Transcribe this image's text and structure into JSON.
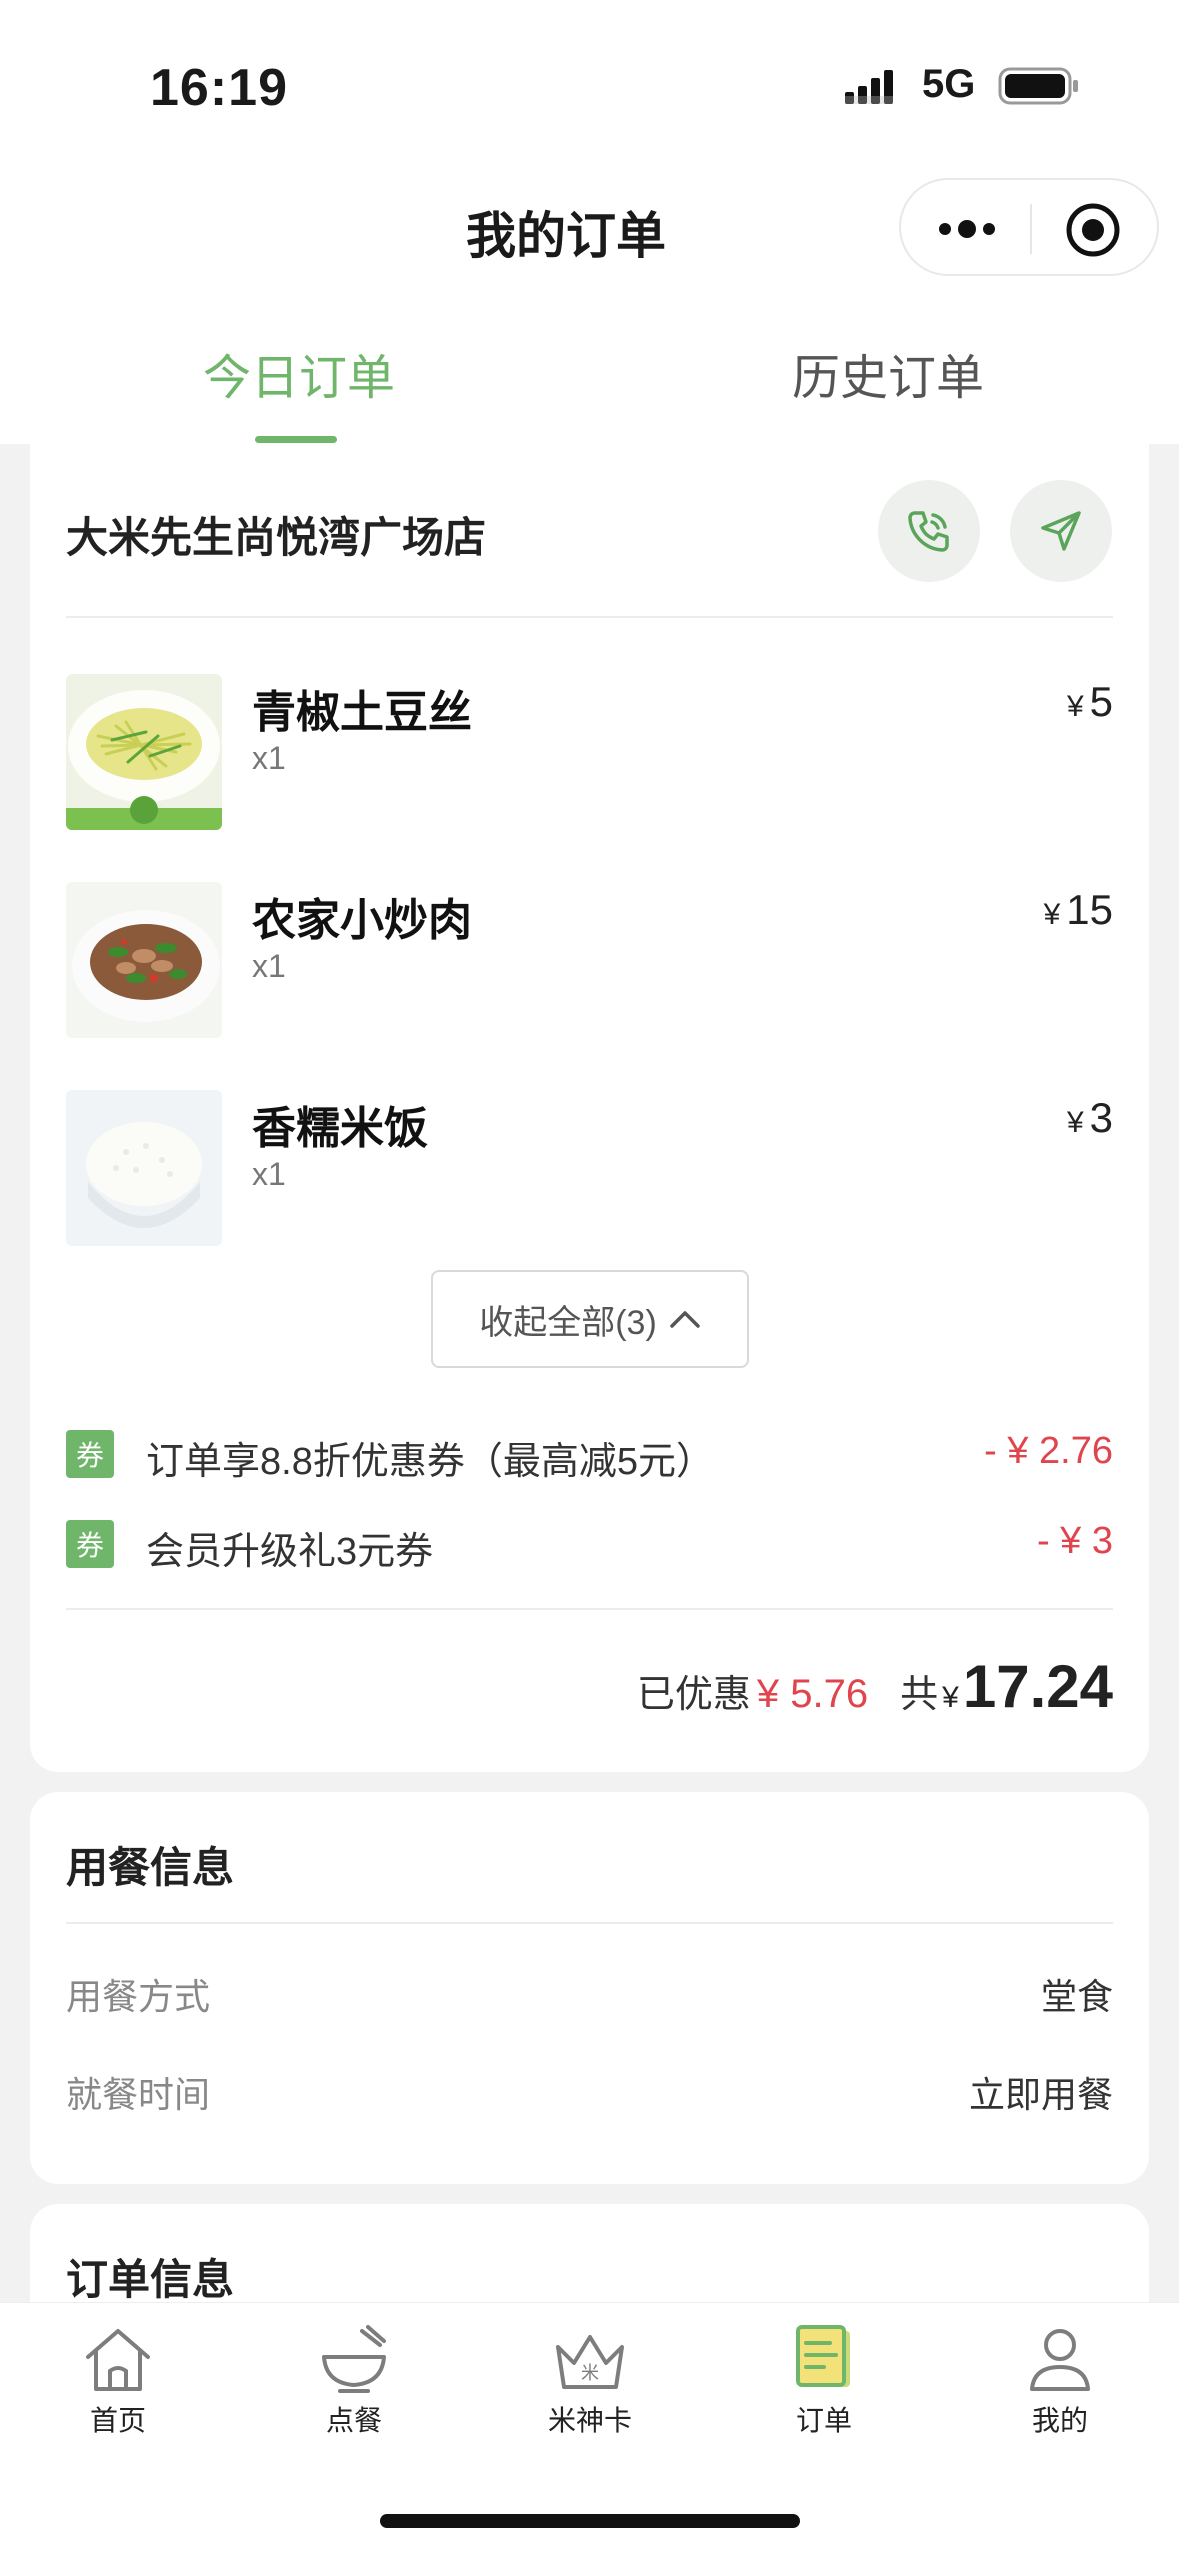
{
  "status_bar": {
    "time": "16:19",
    "network": "5G"
  },
  "nav": {
    "title": "我的订单",
    "more_icon": "more-dots-icon",
    "target_icon": "target-icon"
  },
  "tabs": [
    {
      "label": "今日订单",
      "active": true
    },
    {
      "label": "历史订单",
      "active": false
    }
  ],
  "order": {
    "store_name": "大米先生尚悦湾广场店",
    "items": [
      {
        "name": "青椒土豆丝",
        "qty": "x1",
        "currency": "¥",
        "price": "5"
      },
      {
        "name": "农家小炒肉",
        "qty": "x1",
        "currency": "¥",
        "price": "15"
      },
      {
        "name": "香糯米饭",
        "qty": "x1",
        "currency": "¥",
        "price": "3"
      }
    ],
    "collapse_label": "收起全部(3)",
    "coupons": [
      {
        "badge": "券",
        "text": "订单享8.8折优惠券（最高减5元）",
        "amount": "- ¥ 2.76"
      },
      {
        "badge": "券",
        "text": "会员升级礼3元券",
        "amount": "- ¥ 3"
      }
    ],
    "discount_label": "已优惠",
    "discount_value": "¥ 5.76",
    "total_label": "共",
    "total_currency": "¥",
    "total_value": "17.24"
  },
  "dining": {
    "title": "用餐信息",
    "rows": [
      {
        "key": "用餐方式",
        "value": "堂食"
      },
      {
        "key": "就餐时间",
        "value": "立即用餐"
      }
    ]
  },
  "order_info": {
    "title": "订单信息"
  },
  "tabbar": [
    {
      "label": "首页",
      "icon": "home-icon"
    },
    {
      "label": "点餐",
      "icon": "bowl-icon"
    },
    {
      "label": "米神卡",
      "icon": "crown-card-icon"
    },
    {
      "label": "订单",
      "icon": "order-list-icon",
      "active": true
    },
    {
      "label": "我的",
      "icon": "user-icon"
    }
  ],
  "colors": {
    "accent": "#6fb56a",
    "discount": "#e0454d"
  }
}
